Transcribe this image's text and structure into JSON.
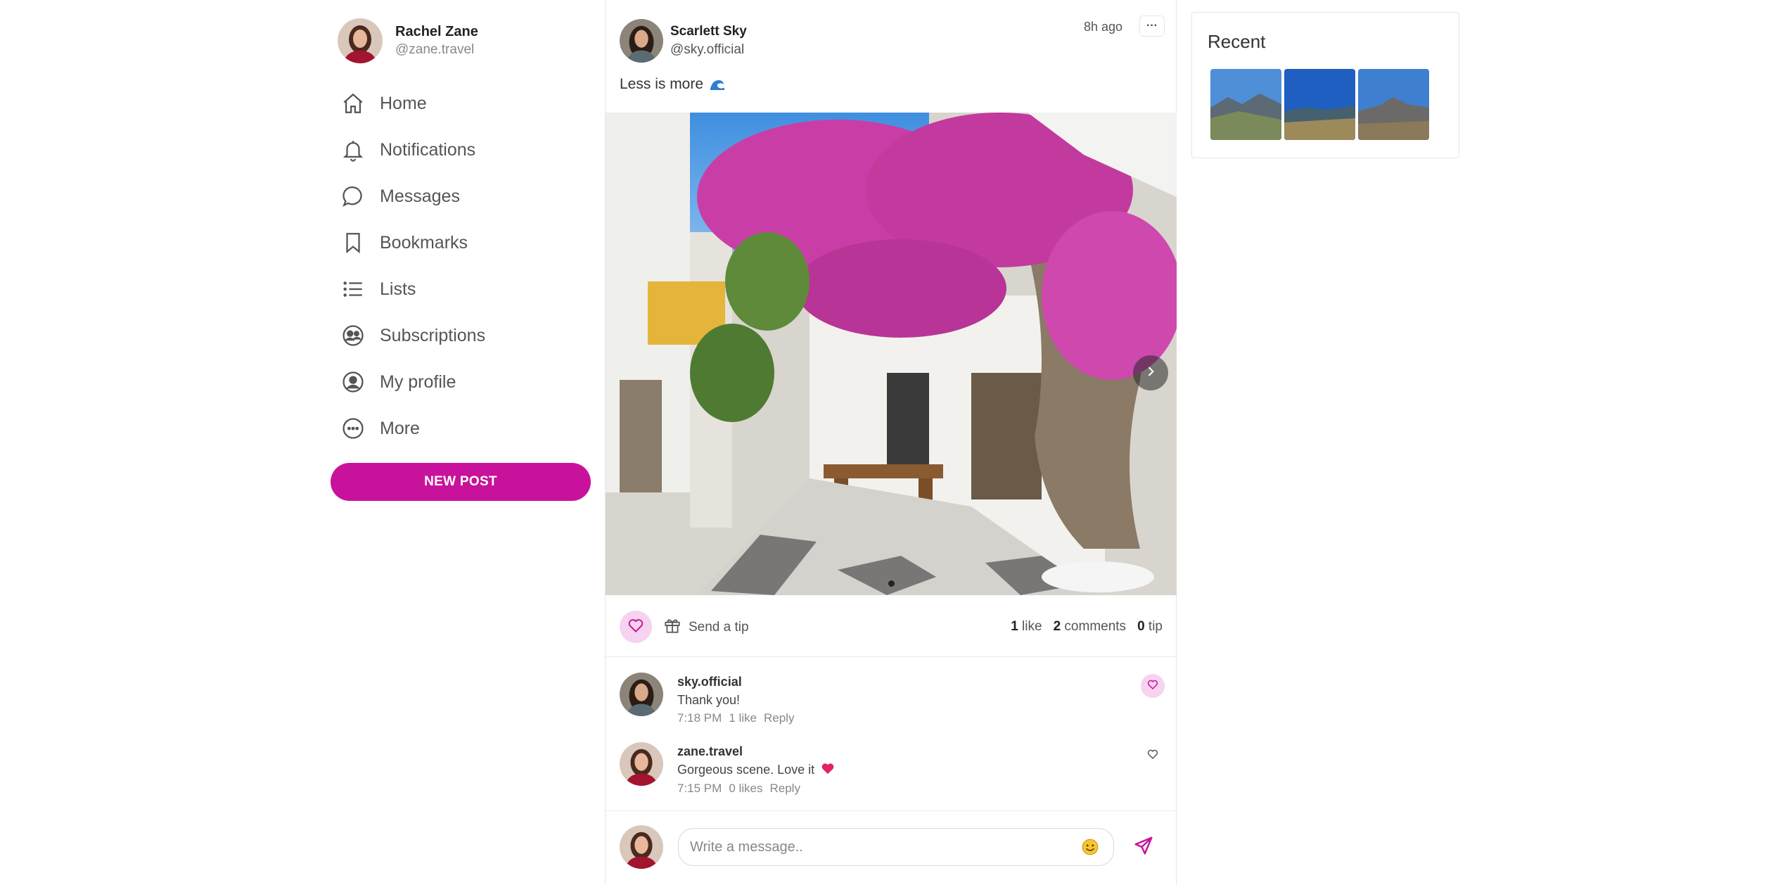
{
  "user": {
    "name": "Rachel Zane",
    "handle": "@zane.travel"
  },
  "nav": [
    {
      "id": "home",
      "label": "Home",
      "icon": "home-icon"
    },
    {
      "id": "notifications",
      "label": "Notifications",
      "icon": "bell-icon"
    },
    {
      "id": "messages",
      "label": "Messages",
      "icon": "chat-bubble-icon"
    },
    {
      "id": "bookmarks",
      "label": "Bookmarks",
      "icon": "bookmark-icon"
    },
    {
      "id": "lists",
      "label": "Lists",
      "icon": "list-icon"
    },
    {
      "id": "subscriptions",
      "label": "Subscriptions",
      "icon": "subscriptions-icon"
    },
    {
      "id": "my-profile",
      "label": "My profile",
      "icon": "user-circle-icon"
    },
    {
      "id": "more",
      "label": "More",
      "icon": "ellipsis-circle-icon"
    }
  ],
  "new_post_label": "NEW POST",
  "post": {
    "author_name": "Scarlett Sky",
    "author_handle": "@sky.official",
    "time": "8h ago",
    "more_label": "···",
    "text": "Less is more",
    "text_icon": "wave-icon",
    "send_tip_label": "Send a tip",
    "likes_count": "1",
    "likes_word": "like",
    "comments_count": "2",
    "comments_word": "comments",
    "tips_count": "0",
    "tips_word": "tip"
  },
  "comments": [
    {
      "user": "sky.official",
      "text": "Thank you!",
      "time": "7:18 PM",
      "likes": "1 like",
      "reply": "Reply",
      "liked": true
    },
    {
      "user": "zane.travel",
      "text": "Gorgeous scene. Love it",
      "time": "7:15 PM",
      "likes": "0 likes",
      "reply": "Reply",
      "liked": false
    }
  ],
  "composer": {
    "placeholder": "Write a message.."
  },
  "recent": {
    "title": "Recent"
  },
  "colors": {
    "brand": "#c8129c",
    "like_bg": "#f6d3ee"
  }
}
